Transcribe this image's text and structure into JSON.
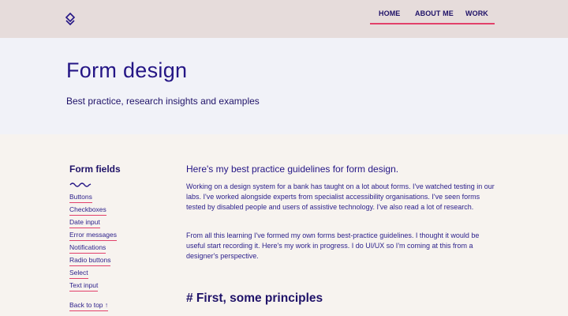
{
  "header": {
    "nav": [
      "HOME",
      "ABOUT ME",
      "WORK"
    ],
    "colors": {
      "accent": "#e2406a",
      "brand": "#241585",
      "header_bg": "#e6dcdb",
      "hero_bg": "#f1f2f8",
      "page_bg": "#f7f3ef"
    },
    "logo_icon": "diamond-logo-icon"
  },
  "hero": {
    "title": "Form design",
    "subtitle": "Best practice, research insights and examples"
  },
  "sidebar": {
    "title": "Form fields",
    "decoration_icon": "squiggle-icon",
    "items": [
      "Buttons",
      "Checkboxes",
      "Date input",
      "Error messages",
      "Notifications",
      "Radio buttons",
      "Select",
      "Text input"
    ],
    "back_to_top": "Back to top ↑"
  },
  "content": {
    "heading": "Here's my best practice guidelines for form design.",
    "paragraphs": [
      "Working on a design system for a bank has taught on a lot about forms. I've watched testing in our labs. I've worked alongside experts from specialist accessibility organisations. I've seen forms tested by disabled people and users of assistive technology. I've also read a lot of research.",
      "From all this learning I've formed my own forms best-practice guidelines. I thought it would be useful start recording it. Here's my work in progress. I do UI/UX so I'm coming at this from a designer's perspective."
    ],
    "section_heading": "# First, some principles"
  }
}
